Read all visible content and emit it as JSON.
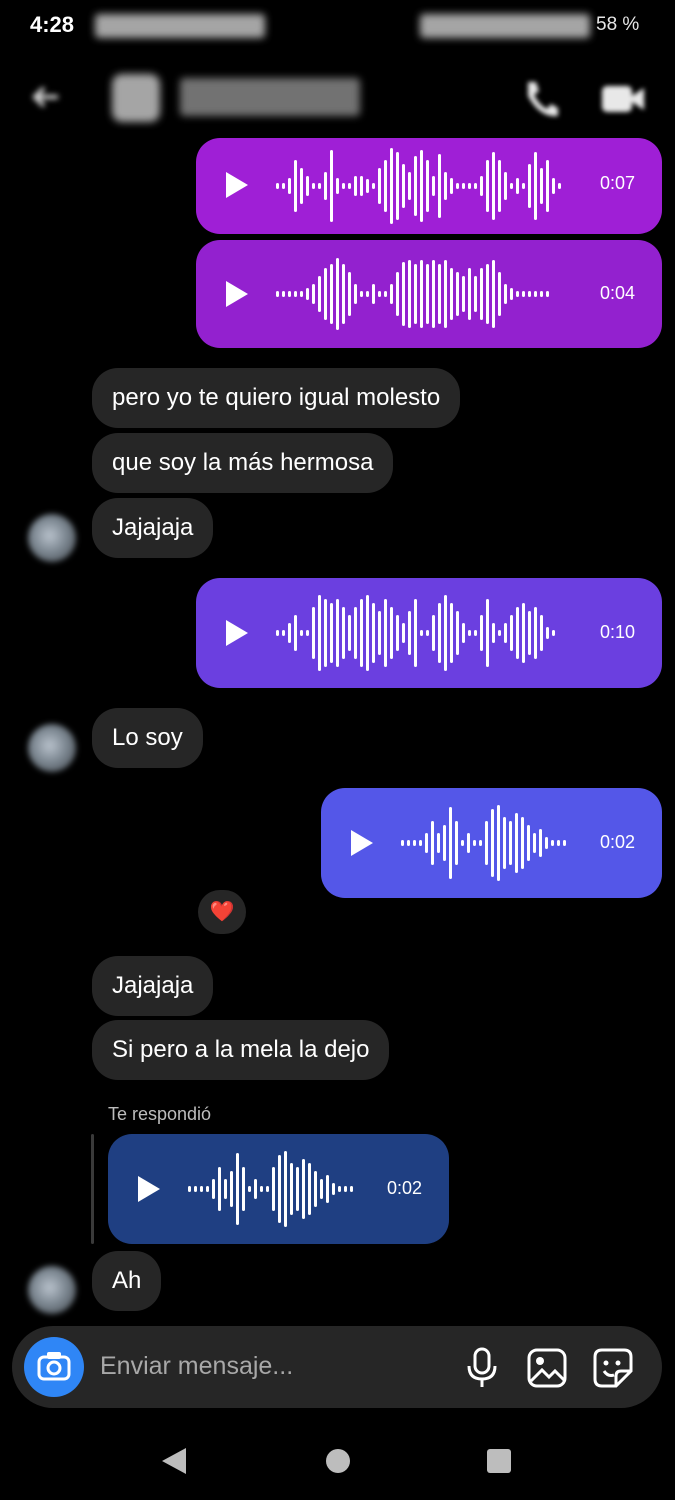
{
  "status_bar": {
    "time": "4:28",
    "battery": "58 %"
  },
  "messages": {
    "voice1_duration": "0:07",
    "voice2_duration": "0:04",
    "text1": "pero yo te quiero igual molesto",
    "text2": "que soy la más hermosa",
    "text3": "Jajajaja",
    "voice3_duration": "0:10",
    "text4": "Lo soy",
    "voice4_duration": "0:02",
    "reaction": "❤️",
    "text5": "Jajajaja",
    "text6": "Si pero a la mela la dejo",
    "reply_label": "Te respondió",
    "reply_voice_duration": "0:02",
    "text7": "Ah"
  },
  "composer": {
    "placeholder": "Enviar mensaje..."
  },
  "colors": {
    "voice1": "#9f1fd6",
    "voice2": "#9321cf",
    "voice3": "#6b3fe0",
    "voice4": "#5457e8",
    "reply_voice": "#1f3f82",
    "incoming_bubble": "#262626",
    "camera_button": "#2f86f6"
  },
  "icons": {
    "camera": "camera-icon",
    "microphone": "microphone-icon",
    "gallery": "gallery-icon",
    "sticker": "sticker-icon",
    "call": "phone-icon",
    "video": "video-icon",
    "back": "back-arrow-icon"
  }
}
